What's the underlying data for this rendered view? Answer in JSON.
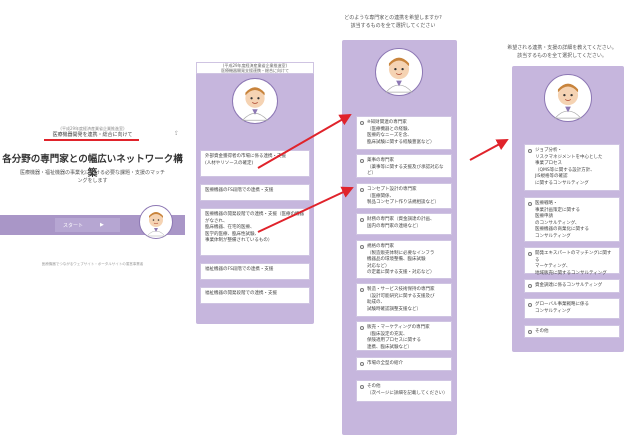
{
  "panel1": {
    "subtitle": "(平成29年度経済産業省企業推進室)",
    "link_text": "医療機器開発を連携・総合に向けて",
    "title": "各分野の専門家との幅広いネットワーク構築",
    "description": "医療機器・福祉機器の事業化における必要な課題・支援のマッチングをします",
    "start_button": "スタート",
    "start_arrow": "▶",
    "footer": "医療機器でつながるウェブサイト・ポータルサイトの運営事業者"
  },
  "panel2": {
    "header": "医療機器開発支援連携・総合に向けて",
    "header_sub": "(平成29年度経済産業省企業推進室)",
    "items": [
      "外部資金獲得者の市場に係る連携・支援\n(人材やリソースの確定)",
      "医療機器のFS段階での連携・支援",
      "医療機器の開発段階での連携・支援（医療の機器がなされ、\n臨床機器、在宅的医療、\n医学的医療、臨床性試験、\n事業体制が整備されているもの）",
      "福祉機器のFS段階での連携・支援",
      "福祉機器の開発段階での連携・支援"
    ]
  },
  "panel3": {
    "question": "どのような専門家との連携を希望しますか?\n該当するものを全て選択してください",
    "items": [
      "※知財関連の専門家\n（医療機器との経験、\n医療的なニーズを含、\n臨床試験に関する経験豊富など）",
      "薬事の専門家\n（薬事等に関する支援及び承認対応など）",
      "コンセプト設計の専門家\n（医療関係、\n製品コンセプト作り法規相談など）",
      "財務の専門家（資金調達の計画、\n国内の専門家の連絡など）",
      "規格の専門家\n（製造販売体制に必要なインフラ\n機器品の環境整備、臨床試験\n対応など）\nの定義に関する支援・対応など）",
      "製造・サービス技術保持の専門家\n（設計可能研究に関する支援及び\n助成の、\n試験時確認調整支援など）",
      "販売・マーケティングの専門家\n（臨床設定の充実、\n保険適用プロセスに関する\n連携、臨床試験など）",
      "市場の全型の紹介",
      "その他\n（次ページに詳細を記載してください）"
    ]
  },
  "panel4": {
    "question": "希望される連携・支援の詳細を教えてください。\n該当するものを全て選択してください。",
    "items": [
      "ジョブ分析・\nリスクマネジメントを中心とした\n事業プロセス\n（QMS等に関する設計方針、\nJIS規格等の確認\nに関するコンサルティング",
      "医療戦略・\n事業計画策定に関する\n医療申請\nのコンサルティング、\n医療機器の商業化に関する\nコンサルティング",
      "開発エキスパートのマッチングに関する\nマーケティング、\n地域販売に関するコンサルティング",
      "資金調達に係るコンサルティング",
      "グローバル事業戦略に係る\nコンサルティング",
      "その他"
    ]
  },
  "colors": {
    "panel_purple": "#c6b6dd",
    "accent_red": "#e0232b",
    "bar_purple": "#a996c7"
  }
}
